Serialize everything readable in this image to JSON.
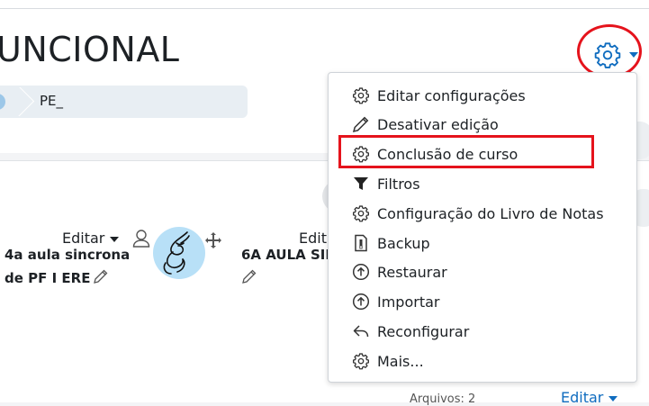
{
  "header": {
    "title": "UNCIONAL",
    "breadcrumb": [
      "PE_"
    ]
  },
  "colors": {
    "accent": "#0f6cbf",
    "annotation": "#e5131c",
    "avatar_bg": "#b8e0f7"
  },
  "cards": [
    {
      "edit_label": "Editar",
      "title_line1": "4a aula sincrona",
      "title_line2": "de PF I ERE"
    },
    {
      "edit_label": "Edita",
      "title_line1": "6A AULA SIN"
    }
  ],
  "footer": {
    "files_label": "Arquivos: 2",
    "edit_label": "Editar"
  },
  "menu": {
    "items": [
      {
        "label": "Editar configurações",
        "icon": "gear-icon"
      },
      {
        "label": "Desativar edição",
        "icon": "pencil-icon"
      },
      {
        "label": "Conclusão de curso",
        "icon": "gear-icon"
      },
      {
        "label": "Filtros",
        "icon": "filter-icon"
      },
      {
        "label": "Configuração do Livro de Notas",
        "icon": "gear-icon"
      },
      {
        "label": "Backup",
        "icon": "backup-file-icon"
      },
      {
        "label": "Restaurar",
        "icon": "upload-circle-icon"
      },
      {
        "label": "Importar",
        "icon": "upload-circle-icon"
      },
      {
        "label": "Reconfigurar",
        "icon": "reply-icon"
      },
      {
        "label": "Mais...",
        "icon": "gear-icon"
      }
    ]
  }
}
